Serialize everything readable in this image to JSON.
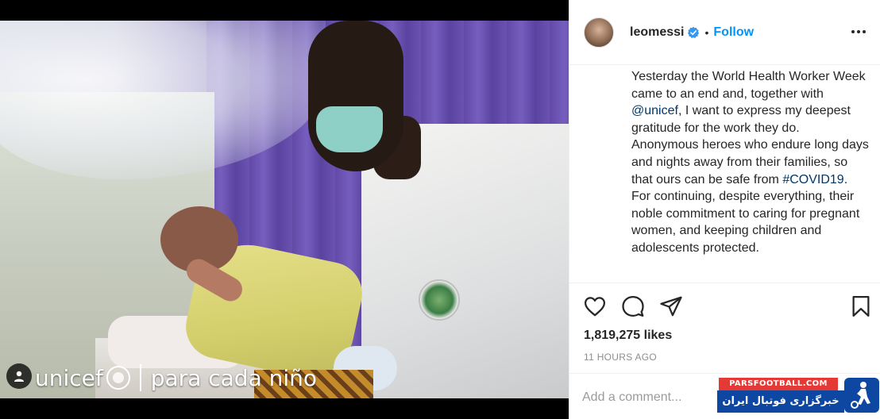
{
  "post": {
    "username": "leomessi",
    "separator": "•",
    "follow_label": "Follow",
    "caption_paragraphs": [
      {
        "pre": "Yesterday the World Health Worker Week came to an end and, together with ",
        "link": "@unicef",
        "post": ", I want to express my deepest gratitude for the work they do."
      },
      {
        "pre": "Anonymous heroes who endure long days and nights away from their families, so that ours can be safe from ",
        "link": "#COVID19",
        "post": "."
      },
      {
        "pre": "For continuing, despite everything, their noble commitment to caring for pregnant women, and keeping children and adolescents protected.",
        "link": "",
        "post": ""
      }
    ],
    "likes": "1,819,275 likes",
    "timestamp": "11 HOURS AGO",
    "comment_placeholder": "Add a comment..."
  },
  "media": {
    "watermark_brand": "unicef",
    "watermark_tagline": "para cada niño"
  },
  "overlay": {
    "site_url": "PARSFOOTBALL.COM",
    "site_name": "خبرگزاری فوتبال ایران"
  },
  "colors": {
    "follow_blue": "#0095f6",
    "link_blue": "#00376b",
    "verified_blue": "#3897f0",
    "muted_gray": "#8e8e8e"
  },
  "icons": [
    "user-tag-icon",
    "verified-badge-icon",
    "more-options-icon",
    "heart-icon",
    "comment-icon",
    "share-icon",
    "bookmark-icon",
    "parsfootball-logo-icon"
  ]
}
